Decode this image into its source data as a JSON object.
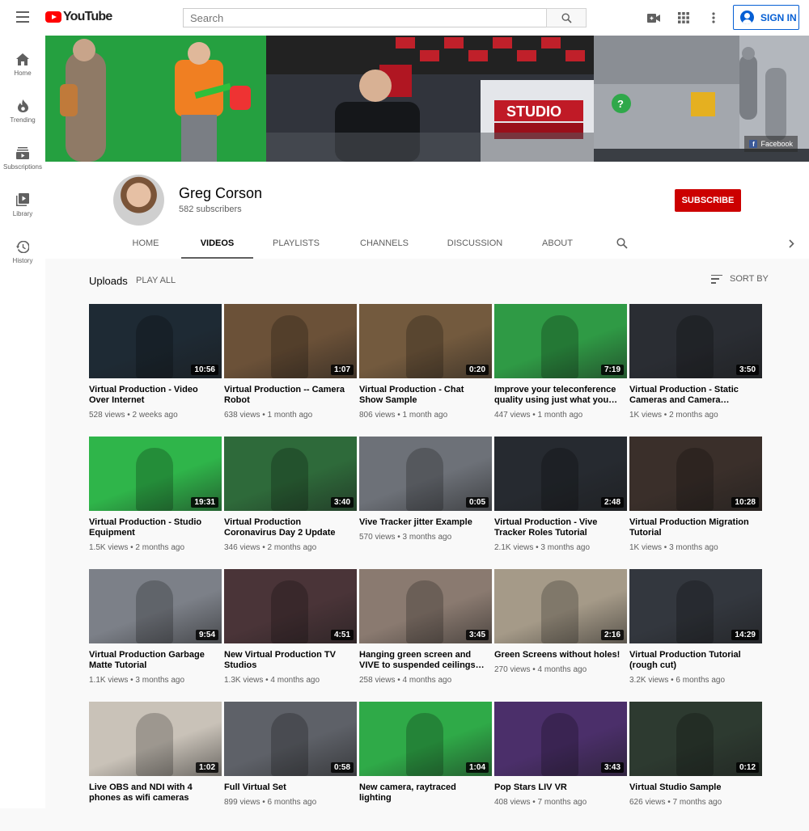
{
  "app": {
    "logo_text": "YouTube"
  },
  "search": {
    "placeholder": "Search"
  },
  "signin": {
    "label": "SIGN IN"
  },
  "sidebar": {
    "items": [
      {
        "label": "Home",
        "icon": "home-icon"
      },
      {
        "label": "Trending",
        "icon": "fire-icon"
      },
      {
        "label": "Subscriptions",
        "icon": "subscriptions-icon"
      },
      {
        "label": "Library",
        "icon": "library-icon"
      },
      {
        "label": "History",
        "icon": "history-icon"
      }
    ]
  },
  "banner": {
    "facebook_label": "Facebook"
  },
  "channel": {
    "name": "Greg Corson",
    "subscribers": "582 subscribers",
    "subscribe_label": "SUBSCRIBE"
  },
  "tabs": [
    {
      "label": "HOME",
      "active": false
    },
    {
      "label": "VIDEOS",
      "active": true
    },
    {
      "label": "PLAYLISTS",
      "active": false
    },
    {
      "label": "CHANNELS",
      "active": false
    },
    {
      "label": "DISCUSSION",
      "active": false
    },
    {
      "label": "ABOUT",
      "active": false
    }
  ],
  "uploads": {
    "title": "Uploads",
    "play_all": "PLAY ALL",
    "sort_by": "SORT BY"
  },
  "videos": [
    {
      "title": "Virtual Production - Video Over Internet",
      "views": "528 views",
      "age": "2 weeks ago",
      "duration": "10:56",
      "color": "#1e2a34"
    },
    {
      "title": "Virtual Production -- Camera Robot",
      "views": "638 views",
      "age": "1 month ago",
      "duration": "1:07",
      "color": "#6b5138"
    },
    {
      "title": "Virtual Production - Chat Show Sample",
      "views": "806 views",
      "age": "1 month ago",
      "duration": "0:20",
      "color": "#735a3e"
    },
    {
      "title": "Improve your teleconference quality using just what you…",
      "views": "447 views",
      "age": "1 month ago",
      "duration": "7:19",
      "color": "#2f9a45"
    },
    {
      "title": "Virtual Production - Static Cameras and Camera…",
      "views": "1K views",
      "age": "2 months ago",
      "duration": "3:50",
      "color": "#2a2d33"
    },
    {
      "title": "Virtual Production - Studio Equipment",
      "views": "1.5K views",
      "age": "2 months ago",
      "duration": "19:31",
      "color": "#2fb54a"
    },
    {
      "title": "Virtual Production Coronavirus Day 2 Update",
      "views": "346 views",
      "age": "2 months ago",
      "duration": "3:40",
      "color": "#2e6a3a"
    },
    {
      "title": "Vive Tracker jitter Example",
      "views": "570 views",
      "age": "3 months ago",
      "duration": "0:05",
      "color": "#6d7178"
    },
    {
      "title": "Virtual Production - Vive Tracker Roles Tutorial",
      "views": "2.1K views",
      "age": "3 months ago",
      "duration": "2:48",
      "color": "#262a30"
    },
    {
      "title": "Virtual Production Migration Tutorial",
      "views": "1K views",
      "age": "3 months ago",
      "duration": "10:28",
      "color": "#3a2f2a"
    },
    {
      "title": "Virtual Production Garbage Matte Tutorial",
      "views": "1.1K views",
      "age": "3 months ago",
      "duration": "9:54",
      "color": "#7c8088"
    },
    {
      "title": "New Virtual Production TV Studios",
      "views": "1.3K views",
      "age": "4 months ago",
      "duration": "4:51",
      "color": "#4a3438"
    },
    {
      "title": "Hanging green screen and VIVE to suspended ceilings…",
      "views": "258 views",
      "age": "4 months ago",
      "duration": "3:45",
      "color": "#8a7a70"
    },
    {
      "title": "Green Screens without holes!",
      "views": "270 views",
      "age": "4 months ago",
      "duration": "2:16",
      "color": "#a59a88"
    },
    {
      "title": "Virtual Production Tutorial (rough cut)",
      "views": "3.2K views",
      "age": "6 months ago",
      "duration": "14:29",
      "color": "#33373e"
    },
    {
      "title": "Live OBS and NDI with 4 phones as wifi cameras",
      "views": "",
      "age": "",
      "duration": "1:02",
      "color": "#c9c2b8"
    },
    {
      "title": "Full Virtual Set",
      "views": "899 views",
      "age": "6 months ago",
      "duration": "0:58",
      "color": "#5e6168"
    },
    {
      "title": "New camera, raytraced lighting",
      "views": "",
      "age": "",
      "duration": "1:04",
      "color": "#2faa48"
    },
    {
      "title": "Pop Stars LIV VR",
      "views": "408 views",
      "age": "7 months ago",
      "duration": "3:43",
      "color": "#4b2f6a"
    },
    {
      "title": "Virtual Studio Sample",
      "views": "626 views",
      "age": "7 months ago",
      "duration": "0:12",
      "color": "#2d3a30"
    }
  ]
}
